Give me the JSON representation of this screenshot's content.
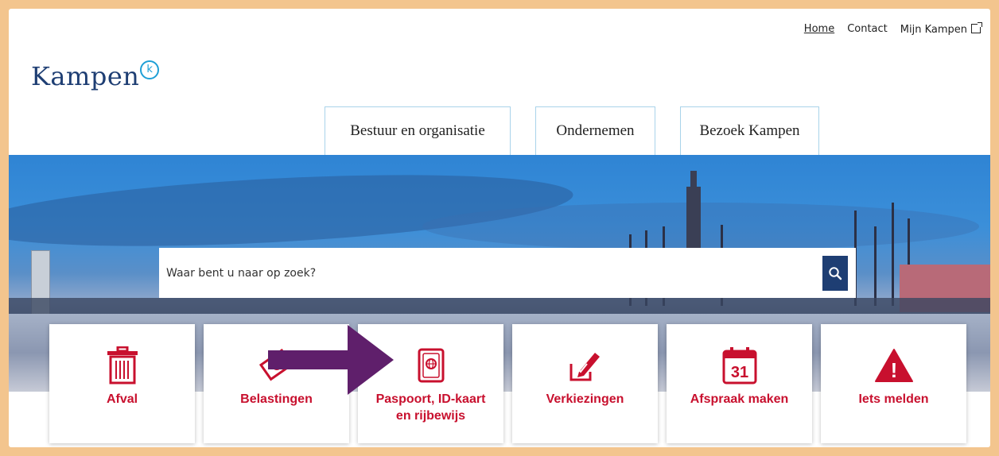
{
  "toplinks": {
    "home": "Home",
    "contact": "Contact",
    "mijn_kampen": "Mijn Kampen"
  },
  "logo": {
    "text": "Kampen",
    "mark": "k"
  },
  "nav": {
    "tabs": [
      {
        "label": "Bestuur en organisatie"
      },
      {
        "label": "Ondernemen"
      },
      {
        "label": "Bezoek Kampen"
      }
    ]
  },
  "search": {
    "placeholder": "Waar bent u naar op zoek?",
    "button_icon": "search-icon"
  },
  "cards": [
    {
      "label": "Afval",
      "icon": "trash-icon"
    },
    {
      "label": "Belastingen",
      "icon": "money-icon"
    },
    {
      "label": "Paspoort, ID-kaart en rijbewijs",
      "icon": "passport-icon"
    },
    {
      "label": "Verkiezingen",
      "icon": "ballot-icon"
    },
    {
      "label": "Afspraak maken",
      "icon": "calendar-icon",
      "calendar_day": "31"
    },
    {
      "label": "Iets melden",
      "icon": "warning-icon",
      "warning_mark": "!"
    }
  ],
  "colors": {
    "brand_blue": "#1e3e73",
    "accent_red": "#c8102e",
    "arrow_purple": "#5f1f6b",
    "frame_orange": "#f3c58e"
  }
}
